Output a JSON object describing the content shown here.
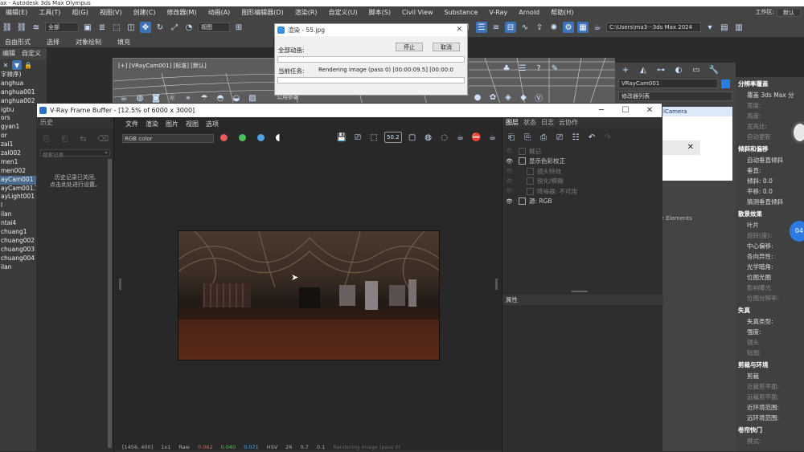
{
  "app_title": "ax - Autodesk 3ds Max Olympus",
  "menu": [
    "编辑(E)",
    "工具(T)",
    "组(G)",
    "视图(V)",
    "创建(C)",
    "修改器(M)",
    "动画(A)",
    "图形编辑器(D)",
    "渲染(R)",
    "自定义(U)",
    "脚本(S)",
    "Civil View",
    "Substance",
    "V-Ray",
    "Arnold",
    "帮助(H)"
  ],
  "workspace_label": "工作区:",
  "workspace_value": "默认",
  "path_box": "C:\\Users\\ma3···3ds Max 2024",
  "toolbar": {
    "selection_filter": "全部",
    "view_dropdown": "视图"
  },
  "ribbon_tabs": [
    "自由形式",
    "选择",
    "对象绘制",
    "填充"
  ],
  "left_panel": {
    "tabs": [
      "编辑",
      "自定义"
    ],
    "sort_label": "字排序)",
    "items": [
      {
        "label": "anghua",
        "highlight": false
      },
      {
        "label": "anghua001",
        "highlight": false
      },
      {
        "label": "anghua002",
        "highlight": false
      },
      {
        "label": "igbu",
        "highlight": false
      },
      {
        "label": "ors",
        "highlight": false
      },
      {
        "label": "gyan1",
        "highlight": false
      },
      {
        "label": "or",
        "highlight": false
      },
      {
        "label": "zal1",
        "highlight": false
      },
      {
        "label": "zal002",
        "highlight": false
      },
      {
        "label": "men1",
        "highlight": false
      },
      {
        "label": "men002",
        "highlight": false
      },
      {
        "label": "ayCam001",
        "highlight": true
      },
      {
        "label": "ayCam001.Ta",
        "highlight": false
      },
      {
        "label": "ayLight001",
        "highlight": false
      },
      {
        "label": "l",
        "highlight": false
      },
      {
        "label": "ilan",
        "highlight": false
      },
      {
        "label": "ntai4",
        "highlight": false
      },
      {
        "label": "chuang1",
        "highlight": false
      },
      {
        "label": "chuang002",
        "highlight": false
      },
      {
        "label": "chuang003",
        "highlight": false
      },
      {
        "label": "chuang004",
        "highlight": false
      },
      {
        "label": "ilan",
        "highlight": false
      }
    ]
  },
  "viewport_label": "[+] [VRayCam001] [标准] [默认]",
  "viewport_tab2": "公用参数",
  "render_dialog": {
    "title": "渲染 - 55.jpg",
    "stop_label": "停止",
    "cancel_label": "取消",
    "total_label": "全部动画:",
    "current_label": "当前任务:",
    "current_value": "Rendering image (pass 0) [00:00:09.5] [00:00:0"
  },
  "vfb": {
    "title": "V-Ray Frame Buffer - [12.5% of 6000 x 3000]",
    "history_tab": "历史",
    "history_search_placeholder": "搜索记录",
    "history_note_1": "历史记录已关闭,",
    "history_note_2": "点击此处进行设置。",
    "menu": [
      "文件",
      "渲染",
      "图片",
      "视图",
      "选项"
    ],
    "channel": "RGB color",
    "zoom_value": "50.2",
    "right_tabs": [
      "图层",
      "状态",
      "日志",
      "云协作"
    ],
    "layers": [
      {
        "label": "概记",
        "dim": true,
        "indent": 0
      },
      {
        "label": "显示色彩校正",
        "dim": false,
        "indent": 0
      },
      {
        "label": "镜头特效",
        "dim": true,
        "indent": 1
      },
      {
        "label": "锐化/模糊",
        "dim": true,
        "indent": 1
      },
      {
        "label": "降噪器: 不可用",
        "dim": true,
        "indent": 1
      },
      {
        "label": "源: RGB",
        "dim": false,
        "indent": 0
      }
    ],
    "props_label": "属性",
    "status": {
      "coords": "[1456, 400]",
      "mode": "1x1",
      "prefix": "Raw",
      "r": "0.062",
      "g": "0.040",
      "b": "0.071",
      "space": "HSV",
      "v1": "26",
      "v2": "0.7",
      "v3": "0.1",
      "msg": "Rendering image (pass 0)"
    }
  },
  "cmd_panel": {
    "object_name": "VRayCam001",
    "modifier_list": "修改器列表",
    "stack_item": "lCamera",
    "elements_label": "r Elements"
  },
  "far_panel": {
    "sections": [
      {
        "title": "分辨率覆盖",
        "rows": [
          {
            "t": "覆盖 3ds Max 分",
            "dim": false
          },
          {
            "t": "宽度:",
            "dim": true
          },
          {
            "t": "高度:",
            "dim": true
          },
          {
            "t": "宽高比:",
            "dim": true
          },
          {
            "t": "自动更新",
            "dim": true
          }
        ]
      },
      {
        "title": "倾斜和偏移",
        "rows": [
          {
            "t": "自动垂直倾斜",
            "dim": false
          },
          {
            "t": "垂直:",
            "dim": false
          },
          {
            "t": "倾斜:   0.0",
            "dim": false
          },
          {
            "t": "平移:   0.0",
            "dim": false
          },
          {
            "t": "猜测垂直倾斜",
            "dim": false
          }
        ]
      },
      {
        "title": "散景效果",
        "rows": [
          {
            "t": "叶片",
            "dim": false
          },
          {
            "t": "旋转(度):",
            "dim": true
          },
          {
            "t": "中心偏移:",
            "dim": false
          },
          {
            "t": "各向异性:",
            "dim": false
          },
          {
            "t": "光学暗角:",
            "dim": false
          },
          {
            "t": "位图光圈",
            "dim": false
          },
          {
            "t": "影响曝光",
            "dim": true
          },
          {
            "t": "位图分辨率:",
            "dim": true
          }
        ]
      },
      {
        "title": "失真",
        "rows": [
          {
            "t": "失真类型:",
            "dim": false
          },
          {
            "t": "强度:",
            "dim": false
          },
          {
            "t": "镜头",
            "dim": true
          },
          {
            "t": "贴图:",
            "dim": true
          }
        ]
      },
      {
        "title": "剪裁与环境",
        "rows": [
          {
            "t": "剪裁",
            "dim": false
          },
          {
            "t": "近裁剪平面:",
            "dim": true
          },
          {
            "t": "远裁剪平面:",
            "dim": true
          },
          {
            "t": "近环境范围:",
            "dim": false
          },
          {
            "t": "远环境范围:",
            "dim": false
          }
        ]
      },
      {
        "title": "卷帘快门",
        "rows": [
          {
            "t": "模式:",
            "dim": true
          }
        ]
      }
    ]
  },
  "badge_text": "04"
}
